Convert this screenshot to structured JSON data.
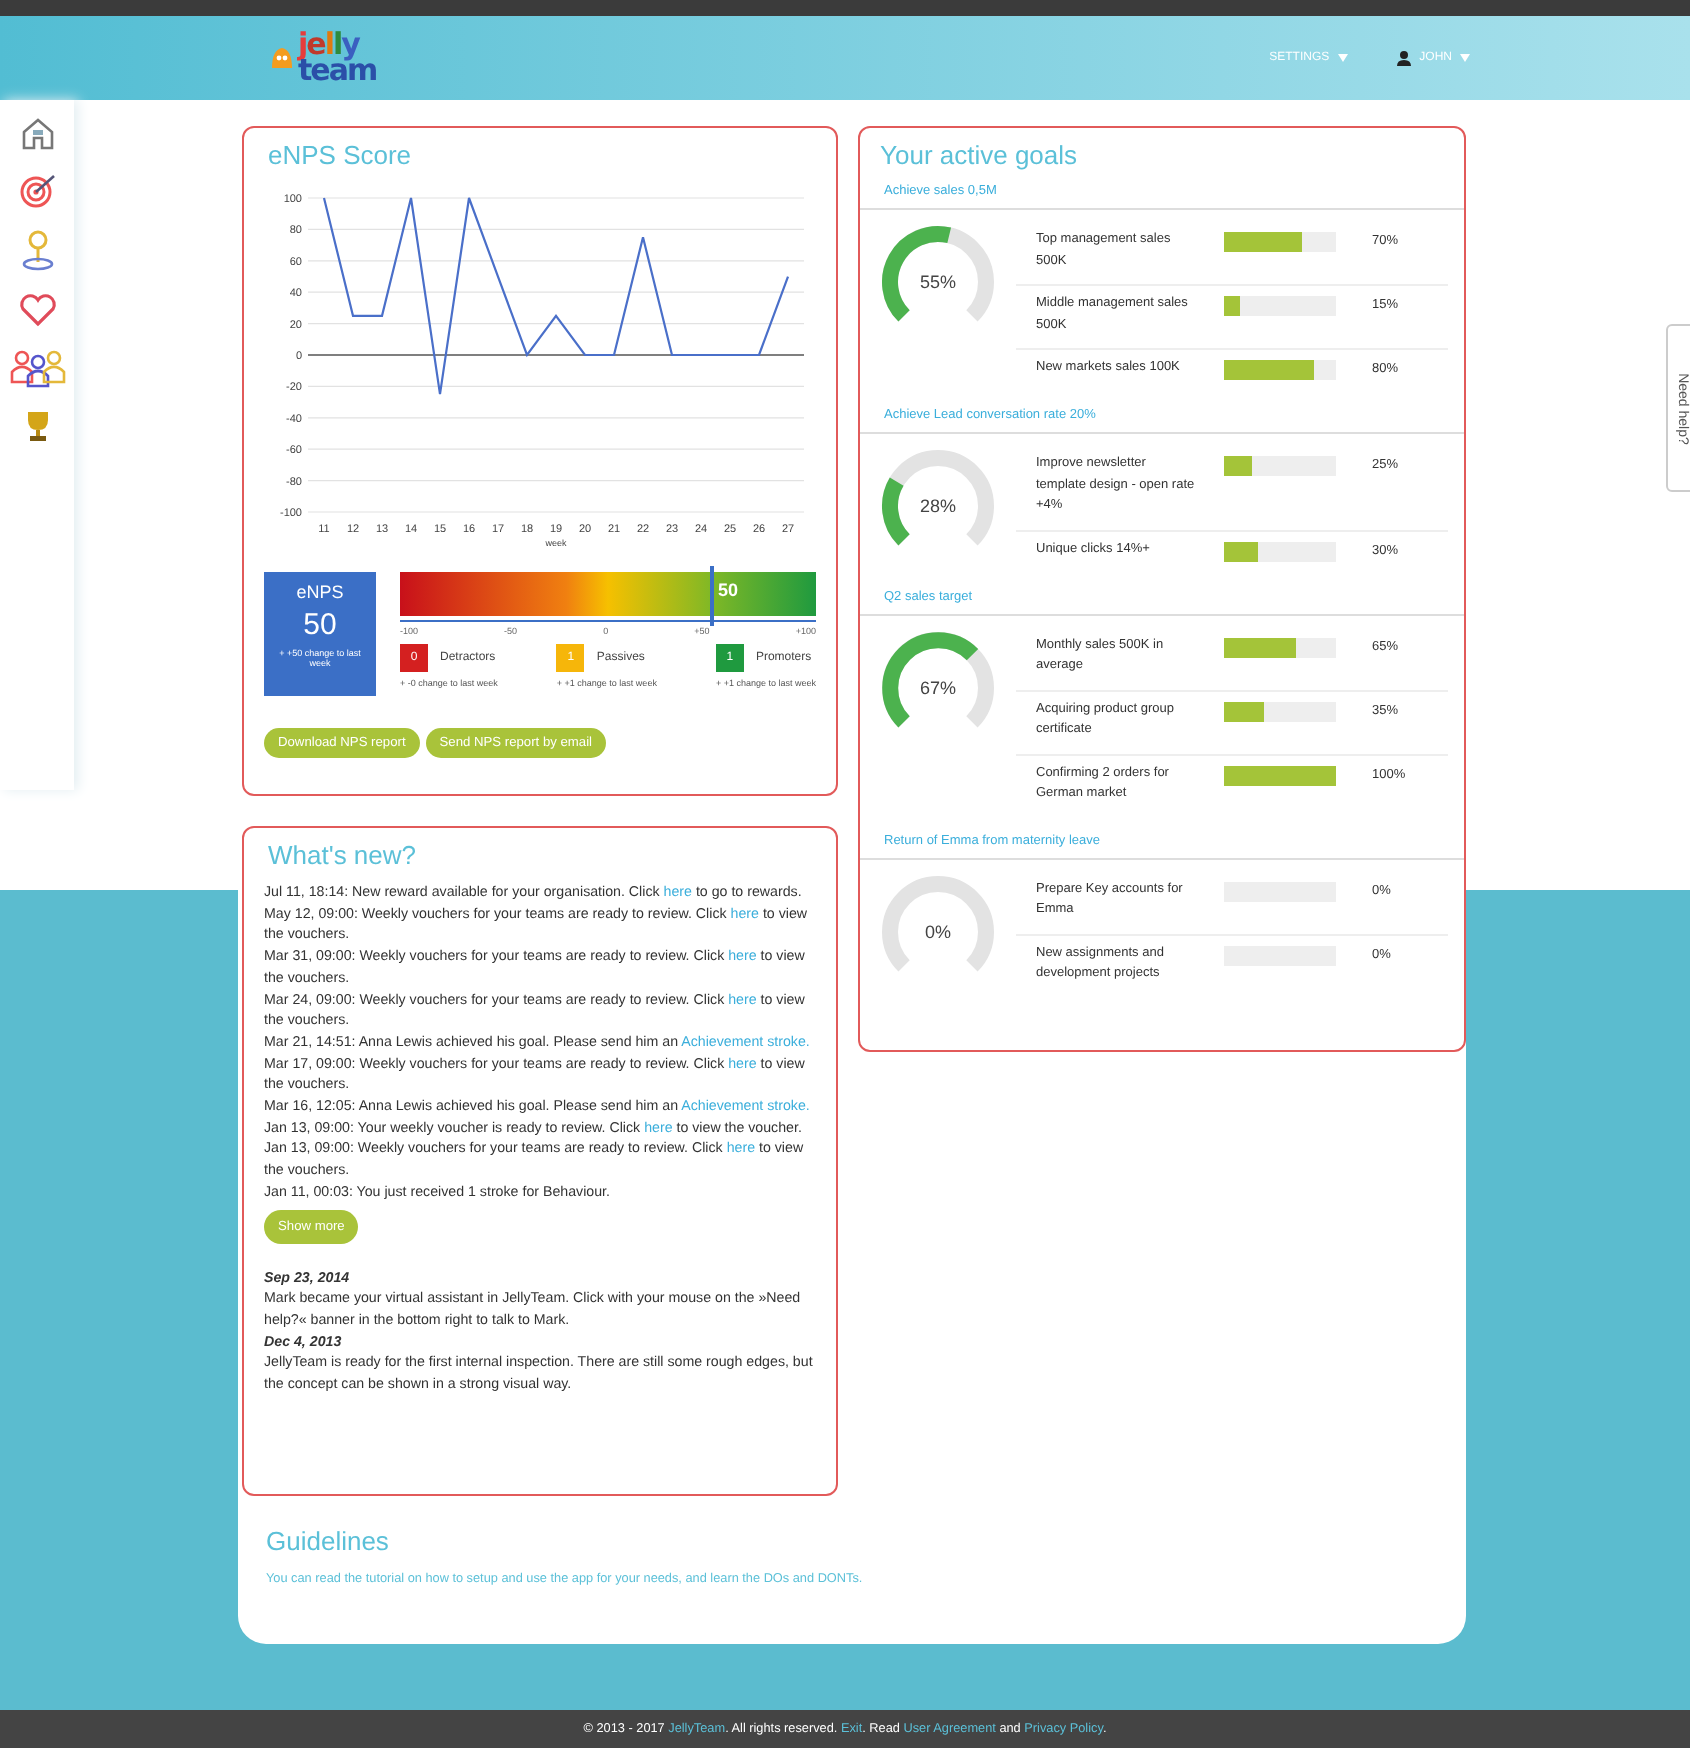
{
  "header": {
    "logo": {
      "line1": "jelly",
      "line2": "team"
    },
    "menu": [
      {
        "label": "SETTINGS",
        "kind": "plain"
      },
      {
        "label": "JOHN",
        "kind": "user"
      }
    ]
  },
  "help_tab": {
    "label": "Need help?"
  },
  "enps": {
    "title": "eNPS Score",
    "chart_data": {
      "type": "line",
      "xlabel": "week",
      "categories": [
        "11",
        "12",
        "13",
        "14",
        "15",
        "16",
        "17",
        "18",
        "19",
        "20",
        "21",
        "22",
        "23",
        "24",
        "25",
        "26",
        "27"
      ],
      "grid": true,
      "series": [
        {
          "color": "#4a6fc9",
          "values": [
            100,
            25,
            25,
            100,
            -25,
            100,
            50,
            0,
            25,
            0,
            0,
            75,
            0,
            0,
            0,
            0,
            50
          ]
        }
      ],
      "ylim": [
        -100,
        100
      ],
      "yticks": [
        -100,
        -80,
        -60,
        -40,
        -20,
        0,
        20,
        40,
        60,
        80,
        100
      ]
    },
    "score": {
      "label": "eNPS",
      "value": "50",
      "change": "+ +50 change to last week"
    },
    "gauge": {
      "level": 0.75,
      "reading": "50",
      "ticks": [
        "-100",
        "-50",
        "0",
        "+50",
        "+100"
      ]
    },
    "groups": [
      {
        "count": "0",
        "label": "Detractors",
        "color": "#d42020",
        "change": "+ -0 change to last week"
      },
      {
        "count": "1",
        "label": "Passives",
        "color": "#f6b60a",
        "change": "+ +1 change to last week"
      },
      {
        "count": "1",
        "label": "Promoters",
        "color": "#1f9a3f",
        "change": "+ +1 change to last week"
      }
    ],
    "buttons": [
      "Download NPS report",
      "Send NPS report by email"
    ]
  },
  "news": {
    "title": "What's new?",
    "items": [
      {
        "text": "Jul 11, 18:14: New reward available for your organisation. Click ",
        "link": "here",
        "after": " to go to rewards."
      },
      {
        "text": "May 12, 09:00: Weekly vouchers for your teams are ready to review. Click ",
        "link": "here",
        "after": " to view the vouchers."
      },
      {
        "text": "Mar 31, 09:00: Weekly vouchers for your teams are ready to review. Click ",
        "link": "here",
        "after": " to view the vouchers."
      },
      {
        "text": "Mar 24, 09:00: Weekly vouchers for your teams are ready to review. Click ",
        "link": "here",
        "after": " to view the vouchers."
      },
      {
        "text": "Mar 21, 14:51: Anna Lewis achieved his goal. Please send him an ",
        "link": "Achievement stroke."
      },
      {
        "text": "Mar 17, 09:00: Weekly vouchers for your teams are ready to review. Click ",
        "link": "here",
        "after": " to view the vouchers."
      },
      {
        "text": "Mar 16, 12:05: Anna Lewis achieved his goal. Please send him an ",
        "link": "Achievement stroke."
      },
      {
        "text": "Jan 13, 09:00: Your weekly voucher is ready to review. Click ",
        "link": "here",
        "after": " to view the voucher."
      },
      {
        "text": "Jan 13, 09:00: Weekly vouchers for your teams are ready to review. Click ",
        "link": "here",
        "after": " to view the vouchers."
      },
      {
        "text": "Jan 11, 00:03: You just received 1 stroke for Behaviour."
      }
    ],
    "show_more": "Show more",
    "notes": [
      {
        "date": "Sep 23, 2014",
        "text": "Mark became your virtual assistant in JellyTeam. Click with your mouse on the »Need help?« banner in the bottom right to talk to Mark."
      },
      {
        "date": "Dec 4, 2013",
        "text": "JellyTeam is ready for the first internal inspection. There are still some rough edges, but the concept can be shown in a strong visual way."
      }
    ]
  },
  "guidelines": {
    "title": "Guidelines",
    "text": "You can read the tutorial on how to setup and use the app for your needs, and learn the DOs and DONTs."
  },
  "goals": {
    "title": "Your active goals",
    "groups": [
      {
        "name": "Achieve sales 0,5M",
        "reading": "55%",
        "items": [
          {
            "name": "Top management sales 500K",
            "level": 0.7,
            "reading": "70%"
          },
          {
            "name": "Middle management sales 500K",
            "level": 0.15,
            "reading": "15%"
          },
          {
            "name": "New markets sales 100K",
            "level": 0.8,
            "reading": "80%"
          }
        ]
      },
      {
        "name": "Achieve Lead conversation rate 20%",
        "reading": "28%",
        "items": [
          {
            "name": "Improve newsletter template design - open rate +4%",
            "level": 0.25,
            "reading": "25%"
          },
          {
            "name": "Unique clicks 14%+",
            "level": 0.3,
            "reading": "30%"
          }
        ]
      },
      {
        "name": "Q2 sales target",
        "reading": "67%",
        "items": [
          {
            "name": "Monthly sales 500K in average",
            "level": 0.65,
            "reading": "65%"
          },
          {
            "name": "Acquiring product group certificate",
            "level": 0.35,
            "reading": "35%"
          },
          {
            "name": "Confirming 2 orders for German market",
            "level": 1,
            "reading": "100%"
          }
        ]
      },
      {
        "name": "Return of Emma from maternity leave",
        "reading": "0%",
        "items": [
          {
            "name": "Prepare Key accounts for Emma",
            "level": 0,
            "reading": "0%"
          },
          {
            "name": "New assignments and development projects",
            "level": 0,
            "reading": "0%"
          }
        ]
      }
    ]
  },
  "footer": [
    {
      "text": "© 2013 - 2017 ",
      "kind": "text"
    },
    {
      "text": "JellyTeam",
      "kind": "link"
    },
    {
      "text": ". All rights reserved. ",
      "kind": "text"
    },
    {
      "text": "Exit",
      "kind": "link"
    },
    {
      "text": ". Read ",
      "kind": "text"
    },
    {
      "text": "User Agreement",
      "kind": "link"
    },
    {
      "text": " and ",
      "kind": "text"
    },
    {
      "text": "Privacy Policy",
      "kind": "link"
    },
    {
      "text": ".",
      "kind": "text"
    }
  ]
}
